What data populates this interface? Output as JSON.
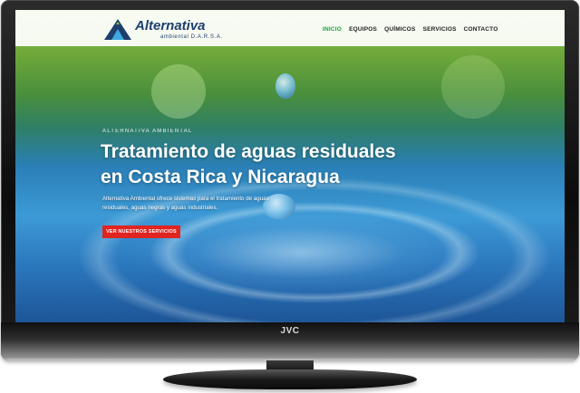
{
  "tv": {
    "brand": "JVC"
  },
  "site": {
    "logo": {
      "name": "Alternativa",
      "subtitle": "ambiental D.A.R.S.A."
    },
    "nav": {
      "items": [
        {
          "label": "INICIO",
          "active": true
        },
        {
          "label": "EQUIPOS",
          "active": false
        },
        {
          "label": "QUÍMICOS",
          "active": false
        },
        {
          "label": "SERVICIOS",
          "active": false
        },
        {
          "label": "CONTACTO",
          "active": false
        }
      ]
    },
    "hero": {
      "eyebrow": "ALTERNATIVA AMBIENTAL",
      "headline_line1": "Tratamiento de aguas residuales",
      "headline_line2": "en Costa Rica y Nicaragua",
      "description": "Alternativa Ambiental ofrece sistemas para el tratamiento de aguas residuales, aguas negras y aguas industriales.",
      "cta_label": "VER NUESTROS SERVICIOS"
    },
    "colors": {
      "brand_navy": "#1e3f6d",
      "nav_active": "#1a9f3b",
      "cta_red": "#e0241f"
    }
  }
}
